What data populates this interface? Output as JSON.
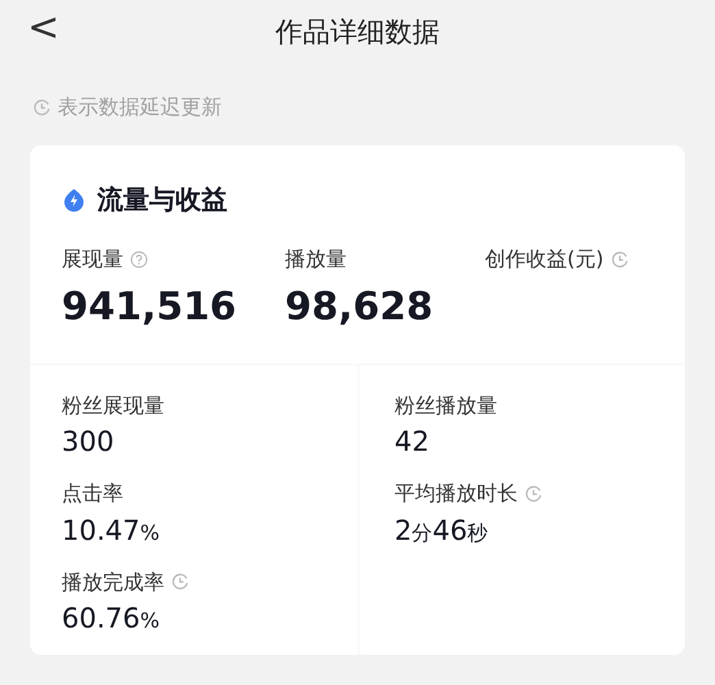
{
  "header": {
    "back": "<",
    "title": "作品详细数据"
  },
  "note": {
    "text": "表示数据延迟更新"
  },
  "card": {
    "title": "流量与收益",
    "top_stats": [
      {
        "label": "展现量",
        "help": true,
        "delayed": false,
        "value": "941,516"
      },
      {
        "label": "播放量",
        "help": false,
        "delayed": false,
        "value": "98,628"
      },
      {
        "label": "创作收益(元)",
        "help": false,
        "delayed": true
      }
    ],
    "columns": [
      [
        {
          "label": "粉丝展现量",
          "delayed": false,
          "value": "300"
        },
        {
          "label": "点击率",
          "delayed": false,
          "value": "10.47%"
        },
        {
          "label": "播放完成率",
          "delayed": true,
          "value": "60.76%"
        }
      ],
      [
        {
          "label": "粉丝播放量",
          "delayed": false,
          "value": "42"
        },
        {
          "label": "平均播放时长",
          "delayed": true,
          "value": "2分46秒"
        }
      ]
    ]
  }
}
